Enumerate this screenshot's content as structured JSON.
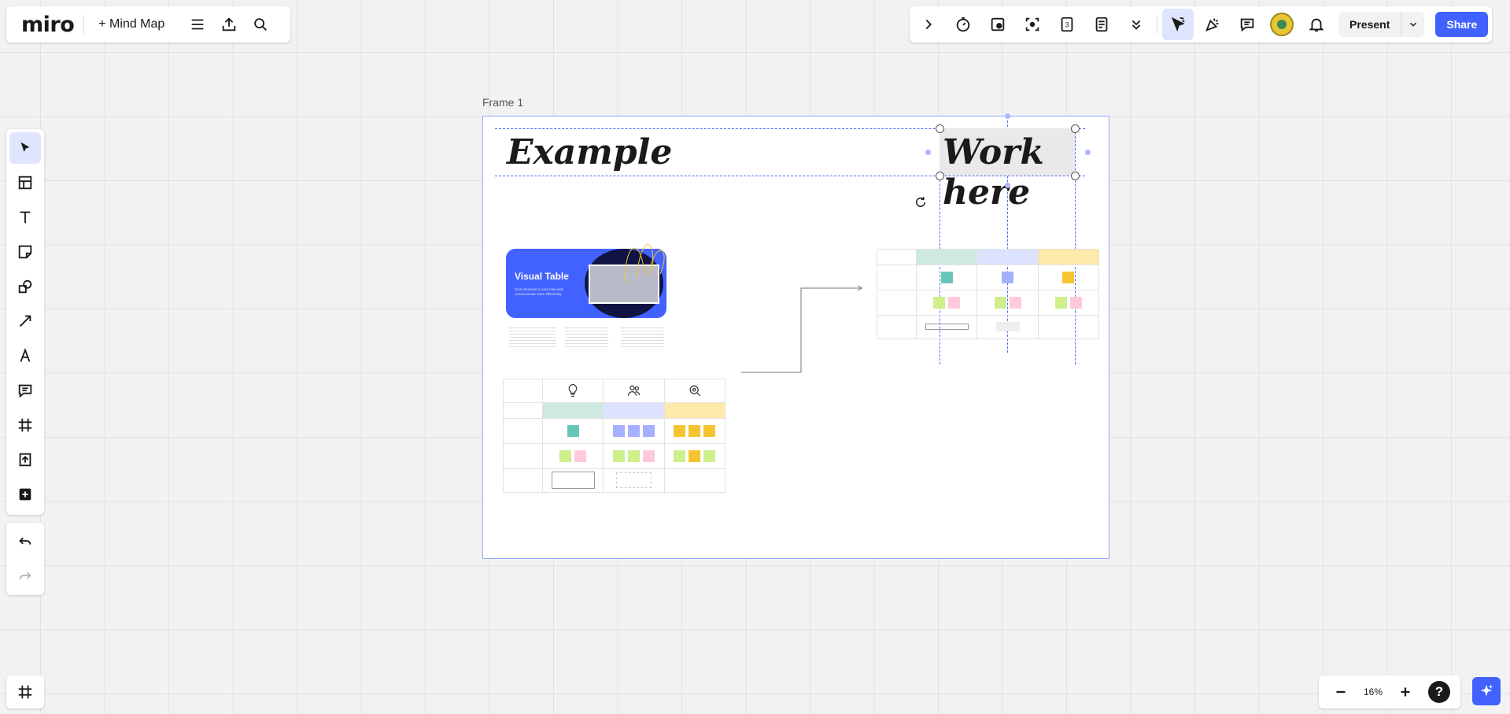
{
  "app": {
    "logo": "miro",
    "mind_map_label": "+ Mind Map"
  },
  "toolbar_right": {
    "present_label": "Present",
    "share_label": "Share"
  },
  "zoom": {
    "level": "16%"
  },
  "help": {
    "label": "?"
  },
  "frame": {
    "label": "Frame 1"
  },
  "board": {
    "example_title": "Example",
    "workhere_title": "Work here",
    "visual_table": {
      "title": "Visual Table",
      "subtitle": "Give structure to your idea and communicate more effectively"
    }
  },
  "colors": {
    "accent": "#4262ff",
    "teal": "#68c6b9",
    "blue": "#a5b0ff",
    "yellow": "#f4c531",
    "lime": "#cfee8c",
    "pink": "#ffc9dc"
  }
}
